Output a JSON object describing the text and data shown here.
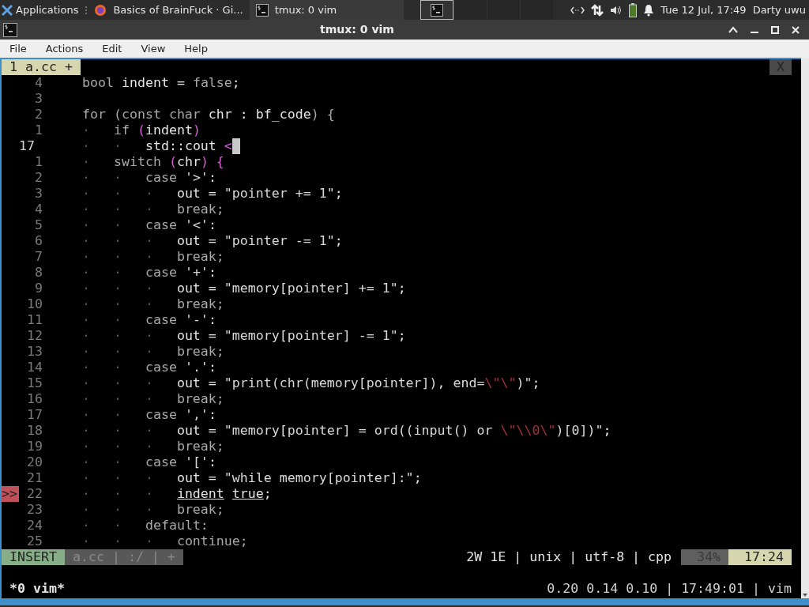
{
  "panel": {
    "applications": "Applications",
    "tasks": [
      {
        "label": "Basics of BrainFuck · Gi...",
        "kind": "browser",
        "selected": false
      },
      {
        "label": "tmux: 0 vim",
        "kind": "terminal",
        "selected": true
      }
    ],
    "workspaces": [
      {
        "selected": true
      },
      {
        "selected": false
      },
      {
        "selected": false
      },
      {
        "selected": false
      }
    ],
    "clock": "Tue 12 Jul, 17:49",
    "user": "Darty uwu"
  },
  "window": {
    "title": "tmux: 0 vim"
  },
  "menu": [
    "File",
    "Actions",
    "Edit",
    "View",
    "Help"
  ],
  "tabline": {
    "tabs": [
      {
        "label": "1 a.cc +",
        "selected": true
      }
    ],
    "close": "X"
  },
  "lines": [
    {
      "num": "4",
      "current": false,
      "tokens": [
        {
          "text": "bool",
          "kind": "keyword"
        },
        {
          "text": " indent = ",
          "kind": "ident"
        },
        {
          "text": "false",
          "kind": "keyword"
        },
        {
          "text": ";",
          "kind": "ident"
        }
      ]
    },
    {
      "num": "3",
      "current": false
    },
    {
      "num": "2",
      "current": false,
      "tokens": [
        {
          "text": "for (const char",
          "kind": "keyword"
        },
        {
          "text": " chr : bf_code",
          "kind": "ident"
        },
        {
          "text": ") {",
          "kind": "keyword"
        }
      ]
    },
    {
      "num": "1",
      "current": false,
      "tokens": [
        {
          "text": "·   ",
          "kind": "guide"
        },
        {
          "text": "if ",
          "kind": "keyword"
        },
        {
          "text": "(",
          "kind": "paren"
        },
        {
          "text": "indent",
          "kind": "ident"
        },
        {
          "text": ")",
          "kind": "paren"
        }
      ]
    },
    {
      "num": "17",
      "current": true,
      "tokens": [
        {
          "text": "·   ·   ",
          "kind": "guide"
        },
        {
          "text": "std::cout ",
          "kind": "ident"
        },
        {
          "text": "<",
          "kind": "paren"
        }
      ]
    },
    {
      "num": "1",
      "current": false,
      "tokens": [
        {
          "text": "·   ",
          "kind": "guide"
        },
        {
          "text": "switch ",
          "kind": "keyword"
        },
        {
          "text": "(",
          "kind": "paren"
        },
        {
          "text": "chr",
          "kind": "ident"
        },
        {
          "text": ") {",
          "kind": "paren"
        }
      ]
    },
    {
      "num": "2",
      "current": false,
      "tokens": [
        {
          "text": "·   ·   ",
          "kind": "guide"
        },
        {
          "text": "case ",
          "kind": "keyword"
        },
        {
          "text": "'>'",
          "kind": "string"
        },
        {
          "text": ":",
          "kind": "ident"
        }
      ]
    },
    {
      "num": "3",
      "current": false,
      "tokens": [
        {
          "text": "·   ·   ·   ",
          "kind": "guide"
        },
        {
          "text": "out = ",
          "kind": "ident"
        },
        {
          "text": "\"pointer += 1\"",
          "kind": "string"
        },
        {
          "text": ";",
          "kind": "ident"
        }
      ]
    },
    {
      "num": "4",
      "current": false,
      "tokens": [
        {
          "text": "·   ·   ·   ",
          "kind": "guide"
        },
        {
          "text": "break;",
          "kind": "keyword"
        }
      ]
    },
    {
      "num": "5",
      "current": false,
      "tokens": [
        {
          "text": "·   ·   ",
          "kind": "guide"
        },
        {
          "text": "case ",
          "kind": "keyword"
        },
        {
          "text": "'<'",
          "kind": "string"
        },
        {
          "text": ":",
          "kind": "ident"
        }
      ]
    },
    {
      "num": "6",
      "current": false,
      "tokens": [
        {
          "text": "·   ·   ·   ",
          "kind": "guide"
        },
        {
          "text": "out = ",
          "kind": "ident"
        },
        {
          "text": "\"pointer -= 1\"",
          "kind": "string"
        },
        {
          "text": ";",
          "kind": "ident"
        }
      ]
    },
    {
      "num": "7",
      "current": false,
      "tokens": [
        {
          "text": "·   ·   ·   ",
          "kind": "guide"
        },
        {
          "text": "break;",
          "kind": "keyword"
        }
      ]
    },
    {
      "num": "8",
      "current": false,
      "tokens": [
        {
          "text": "·   ·   ",
          "kind": "guide"
        },
        {
          "text": "case ",
          "kind": "keyword"
        },
        {
          "text": "'+'",
          "kind": "string"
        },
        {
          "text": ":",
          "kind": "ident"
        }
      ]
    },
    {
      "num": "9",
      "current": false,
      "tokens": [
        {
          "text": "·   ·   ·   ",
          "kind": "guide"
        },
        {
          "text": "out = ",
          "kind": "ident"
        },
        {
          "text": "\"memory[pointer] += 1\"",
          "kind": "string"
        },
        {
          "text": ";",
          "kind": "ident"
        }
      ]
    },
    {
      "num": "10",
      "current": false,
      "tokens": [
        {
          "text": "·   ·   ·   ",
          "kind": "guide"
        },
        {
          "text": "break;",
          "kind": "keyword"
        }
      ]
    },
    {
      "num": "11",
      "current": false,
      "tokens": [
        {
          "text": "·   ·   ",
          "kind": "guide"
        },
        {
          "text": "case ",
          "kind": "keyword"
        },
        {
          "text": "'-'",
          "kind": "string"
        },
        {
          "text": ":",
          "kind": "ident"
        }
      ]
    },
    {
      "num": "12",
      "current": false,
      "tokens": [
        {
          "text": "·   ·   ·   ",
          "kind": "guide"
        },
        {
          "text": "out = ",
          "kind": "ident"
        },
        {
          "text": "\"memory[pointer] -= 1\"",
          "kind": "string"
        },
        {
          "text": ";",
          "kind": "ident"
        }
      ]
    },
    {
      "num": "13",
      "current": false,
      "tokens": [
        {
          "text": "·   ·   ·   ",
          "kind": "guide"
        },
        {
          "text": "break;",
          "kind": "keyword"
        }
      ]
    },
    {
      "num": "14",
      "current": false,
      "tokens": [
        {
          "text": "·   ·   ",
          "kind": "guide"
        },
        {
          "text": "case ",
          "kind": "keyword"
        },
        {
          "text": "'.'",
          "kind": "string"
        },
        {
          "text": ":",
          "kind": "ident"
        }
      ]
    },
    {
      "num": "15",
      "current": false,
      "tokens": [
        {
          "text": "·   ·   ·   ",
          "kind": "guide"
        },
        {
          "text": "out = ",
          "kind": "ident"
        },
        {
          "text": "\"print(chr(memory[pointer]), end=",
          "kind": "string"
        },
        {
          "text": "\\\"\\\"",
          "kind": "escape"
        },
        {
          "text": ")\"",
          "kind": "string"
        },
        {
          "text": ";",
          "kind": "ident"
        }
      ]
    },
    {
      "num": "16",
      "current": false,
      "tokens": [
        {
          "text": "·   ·   ·   ",
          "kind": "guide"
        },
        {
          "text": "break;",
          "kind": "keyword"
        }
      ]
    },
    {
      "num": "17",
      "current": false,
      "tokens": [
        {
          "text": "·   ·   ",
          "kind": "guide"
        },
        {
          "text": "case ",
          "kind": "keyword"
        },
        {
          "text": "','",
          "kind": "string"
        },
        {
          "text": ":",
          "kind": "ident"
        }
      ]
    },
    {
      "num": "18",
      "current": false,
      "tokens": [
        {
          "text": "·   ·   ·   ",
          "kind": "guide"
        },
        {
          "text": "out = ",
          "kind": "ident"
        },
        {
          "text": "\"memory[pointer] = ord((input() or ",
          "kind": "string"
        },
        {
          "text": "\\\"\\\\0\\\"",
          "kind": "escape"
        },
        {
          "text": ")[0])\"",
          "kind": "string"
        },
        {
          "text": ";",
          "kind": "ident"
        }
      ]
    },
    {
      "num": "19",
      "current": false,
      "tokens": [
        {
          "text": "·   ·   ·   ",
          "kind": "guide"
        },
        {
          "text": "break;",
          "kind": "keyword"
        }
      ]
    },
    {
      "num": "20",
      "current": false,
      "tokens": [
        {
          "text": "·   ·   ",
          "kind": "guide"
        },
        {
          "text": "case ",
          "kind": "keyword"
        },
        {
          "text": "'['",
          "kind": "string"
        },
        {
          "text": ":",
          "kind": "ident"
        }
      ]
    },
    {
      "num": "21",
      "current": false,
      "tokens": [
        {
          "text": "·   ·   ·   ",
          "kind": "guide"
        },
        {
          "text": "out = ",
          "kind": "ident"
        },
        {
          "text": "\"while memory[pointer]:\"",
          "kind": "string"
        },
        {
          "text": ";",
          "kind": "ident"
        }
      ]
    },
    {
      "num": "22",
      "current": false,
      "sign": ">>",
      "tokens": [
        {
          "text": "·   ·   ·   ",
          "kind": "guide"
        },
        {
          "text": "indent",
          "kind": "error"
        },
        {
          "text": " true",
          "kind": "error"
        },
        {
          "text": ";",
          "kind": "ident"
        }
      ]
    },
    {
      "num": "23",
      "current": false,
      "tokens": [
        {
          "text": "·   ·   ·   ",
          "kind": "guide"
        },
        {
          "text": "break;",
          "kind": "keyword"
        }
      ]
    },
    {
      "num": "24",
      "current": false,
      "tokens": [
        {
          "text": "·   ·   ",
          "kind": "guide"
        },
        {
          "text": "default:",
          "kind": "keyword"
        }
      ]
    },
    {
      "num": "25",
      "current": false,
      "tokens": [
        {
          "text": "·   ·   ·   ",
          "kind": "guide"
        },
        {
          "text": "continue;",
          "kind": "keyword"
        }
      ]
    }
  ],
  "statusline": {
    "mode": "INSERT",
    "file": "a.cc | :/ | +",
    "info": "2W 1E | unix | utf-8 | cpp",
    "percent": "34%",
    "position": "17:24"
  },
  "tmux": {
    "session": "*0 vim*",
    "status": "0.20 0.14 0.10 | 17:49:01 | vim"
  }
}
